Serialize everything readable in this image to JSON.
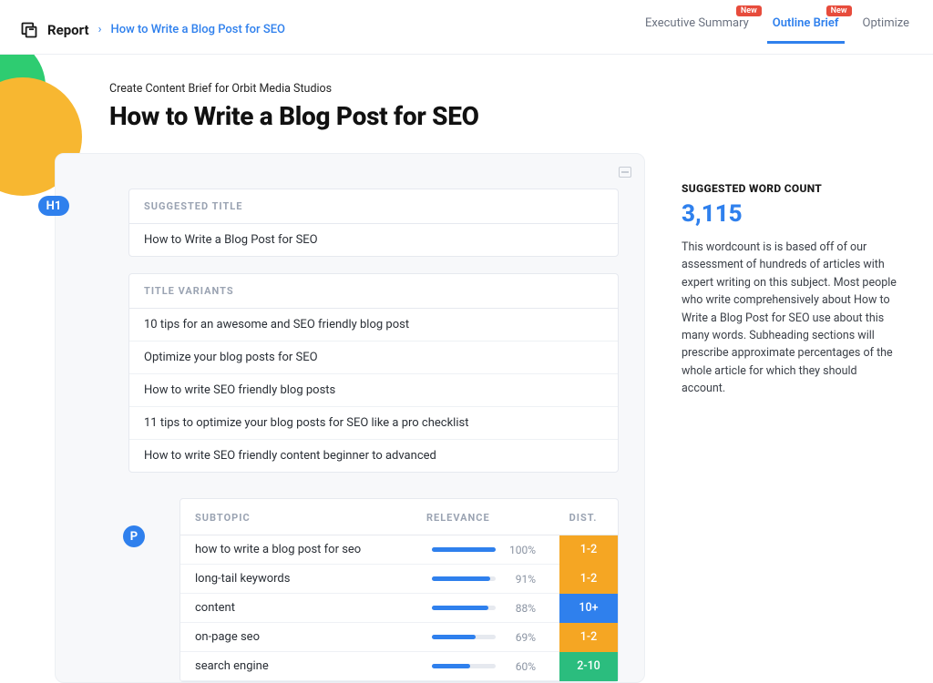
{
  "topbar": {
    "report_label": "Report",
    "crumb_sep": "›",
    "crumb_link": "How to Write a Blog Post for SEO",
    "tabs": {
      "exec": "Executive Summary",
      "outline": "Outline Brief",
      "optimize": "Optimize",
      "new_badge": "New"
    }
  },
  "header": {
    "kicker": "Create Content Brief for Orbit Media Studios",
    "title": "How to Write a Blog Post for SEO"
  },
  "chips": {
    "h1": "H1",
    "p": "P"
  },
  "suggested_title": {
    "label": "SUGGESTED TITLE",
    "value": "How to Write a Blog Post for SEO"
  },
  "title_variants": {
    "label": "TITLE VARIANTS",
    "items": [
      "10 tips for an awesome and SEO friendly blog post",
      "Optimize your blog posts for SEO",
      "How to write SEO friendly blog posts",
      "11 tips to optimize your blog posts for SEO like a pro checklist",
      "How to write SEO friendly content beginner to advanced"
    ]
  },
  "subtopics": {
    "headers": {
      "subtopic": "SUBTOPIC",
      "relevance": "RELEVANCE",
      "dist": "DIST."
    },
    "rows": [
      {
        "label": "how to write a blog post for seo",
        "relevance": "100%",
        "bar": 100,
        "dist": "1-2",
        "dist_class": "dist-yellow"
      },
      {
        "label": "long-tail keywords",
        "relevance": "91%",
        "bar": 91,
        "dist": "1-2",
        "dist_class": "dist-yellow"
      },
      {
        "label": "content",
        "relevance": "88%",
        "bar": 88,
        "dist": "10+",
        "dist_class": "dist-blue"
      },
      {
        "label": "on-page seo",
        "relevance": "69%",
        "bar": 69,
        "dist": "1-2",
        "dist_class": "dist-yellow"
      },
      {
        "label": "search engine",
        "relevance": "60%",
        "bar": 60,
        "dist": "2-10",
        "dist_class": "dist-green"
      }
    ]
  },
  "sidebar": {
    "title": "SUGGESTED WORD COUNT",
    "number": "3,115",
    "text": "This wordcount is is based off of our assessment of hundreds of articles with expert writing on this subject. Most people who write comprehensively about How to Write a Blog Post for SEO use about this many words. Subheading sections will prescribe approximate percentages of the whole article for which they should account."
  }
}
